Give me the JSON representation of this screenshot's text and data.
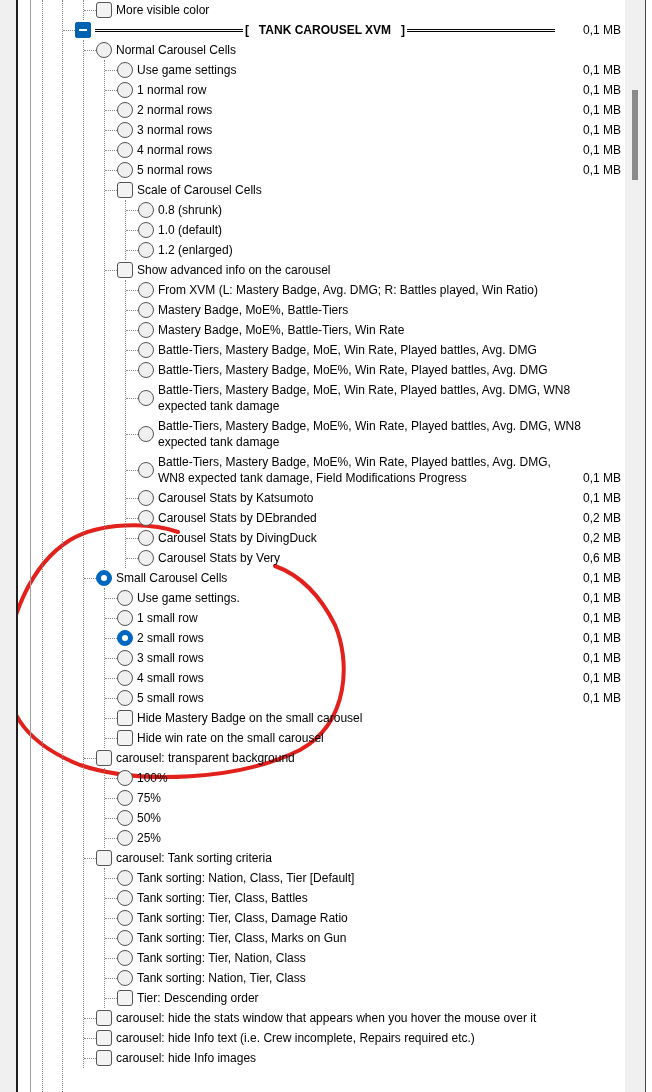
{
  "tree": {
    "items": [
      {
        "kind": "continued",
        "children": [
          {
            "kind": "checkbox",
            "label": "More visible color",
            "checked": false
          }
        ]
      },
      {
        "kind": "header",
        "label": "[   TANK CAROUSEL XVM   ]",
        "size": "0,1 MB",
        "expanded": true,
        "children": [
          {
            "kind": "radio",
            "label": "Normal Carousel Cells",
            "selected": false,
            "children": [
              {
                "kind": "radio",
                "label": "Use game settings",
                "selected": false,
                "size": "0,1 MB"
              },
              {
                "kind": "radio",
                "label": "1 normal row",
                "selected": false,
                "size": "0,1 MB"
              },
              {
                "kind": "radio",
                "label": "2 normal rows",
                "selected": false,
                "size": "0,1 MB"
              },
              {
                "kind": "radio",
                "label": "3 normal rows",
                "selected": false,
                "size": "0,1 MB"
              },
              {
                "kind": "radio",
                "label": "4 normal rows",
                "selected": false,
                "size": "0,1 MB"
              },
              {
                "kind": "radio",
                "label": "5 normal rows",
                "selected": false,
                "size": "0,1 MB"
              },
              {
                "kind": "checkbox",
                "label": "Scale of Carousel Cells",
                "checked": false,
                "children": [
                  {
                    "kind": "radio",
                    "label": "0.8 (shrunk)",
                    "selected": false
                  },
                  {
                    "kind": "radio",
                    "label": "1.0 (default)",
                    "selected": false
                  },
                  {
                    "kind": "radio",
                    "label": "1.2 (enlarged)",
                    "selected": false
                  }
                ]
              },
              {
                "kind": "checkbox",
                "label": "Show advanced info on the carousel",
                "checked": false,
                "children": [
                  {
                    "kind": "radio",
                    "label": "From XVM (L: Mastery Badge, Avg. DMG; R: Battles played, Win Ratio)",
                    "selected": false
                  },
                  {
                    "kind": "radio",
                    "label": "Mastery Badge, MoE%, Battle-Tiers",
                    "selected": false
                  },
                  {
                    "kind": "radio",
                    "label": "Mastery Badge, MoE%, Battle-Tiers, Win Rate",
                    "selected": false
                  },
                  {
                    "kind": "radio",
                    "label": "Battle-Tiers, Mastery Badge, MoE, Win Rate, Played battles, Avg. DMG",
                    "selected": false
                  },
                  {
                    "kind": "radio",
                    "label": "Battle-Tiers, Mastery Badge, MoE%, Win Rate, Played battles, Avg. DMG",
                    "selected": false
                  },
                  {
                    "kind": "radio",
                    "label": "Battle-Tiers, Mastery Badge, MoE, Win Rate, Played battles, Avg. DMG, WN8 expected tank damage",
                    "selected": false
                  },
                  {
                    "kind": "radio",
                    "label": "Battle-Tiers, Mastery Badge, MoE%, Win Rate, Played battles, Avg. DMG, WN8 expected tank damage",
                    "selected": false
                  },
                  {
                    "kind": "radio",
                    "label": "Battle-Tiers, Mastery Badge, MoE%, Win Rate, Played battles, Avg. DMG, WN8 expected tank damage, Field Modifications Progress",
                    "selected": false,
                    "size": "0,1 MB"
                  },
                  {
                    "kind": "radio",
                    "label": "Carousel Stats by Katsumoto",
                    "selected": false,
                    "size": "0,1 MB"
                  },
                  {
                    "kind": "radio",
                    "label": "Carousel Stats by DEbranded",
                    "selected": false,
                    "size": "0,2 MB"
                  },
                  {
                    "kind": "radio",
                    "label": "Carousel Stats by DivingDuck",
                    "selected": false,
                    "size": "0,2 MB"
                  },
                  {
                    "kind": "radio",
                    "label": "Carousel Stats by Very",
                    "selected": false,
                    "size": "0,6 MB"
                  }
                ]
              }
            ]
          },
          {
            "kind": "radio",
            "label": "Small Carousel Cells",
            "selected": true,
            "size": "0,1 MB",
            "children": [
              {
                "kind": "radio",
                "label": "Use game settings.",
                "selected": false,
                "size": "0,1 MB"
              },
              {
                "kind": "radio",
                "label": "1 small row",
                "selected": false,
                "size": "0,1 MB"
              },
              {
                "kind": "radio",
                "label": "2 small rows",
                "selected": true,
                "size": "0,1 MB"
              },
              {
                "kind": "radio",
                "label": "3 small rows",
                "selected": false,
                "size": "0,1 MB"
              },
              {
                "kind": "radio",
                "label": "4 small rows",
                "selected": false,
                "size": "0,1 MB"
              },
              {
                "kind": "radio",
                "label": "5 small rows",
                "selected": false,
                "size": "0,1 MB"
              },
              {
                "kind": "checkbox",
                "label": "Hide Mastery Badge on the small carousel",
                "checked": false
              },
              {
                "kind": "checkbox",
                "label": "Hide win rate on the small carousel",
                "checked": false
              }
            ]
          },
          {
            "kind": "checkbox",
            "label": "carousel: transparent background",
            "checked": false,
            "children": [
              {
                "kind": "radio",
                "label": "100%",
                "selected": false
              },
              {
                "kind": "radio",
                "label": "75%",
                "selected": false
              },
              {
                "kind": "radio",
                "label": "50%",
                "selected": false
              },
              {
                "kind": "radio",
                "label": "25%",
                "selected": false
              }
            ]
          },
          {
            "kind": "checkbox",
            "label": "carousel: Tank sorting criteria",
            "checked": false,
            "children": [
              {
                "kind": "radio",
                "label": "Tank sorting: Nation, Class, Tier [Default]",
                "selected": false
              },
              {
                "kind": "radio",
                "label": "Tank sorting: Tier, Class, Battles",
                "selected": false
              },
              {
                "kind": "radio",
                "label": "Tank sorting: Tier, Class, Damage Ratio",
                "selected": false
              },
              {
                "kind": "radio",
                "label": "Tank sorting: Tier, Class, Marks on Gun",
                "selected": false
              },
              {
                "kind": "radio",
                "label": "Tank sorting: Tier, Nation, Class",
                "selected": false
              },
              {
                "kind": "radio",
                "label": "Tank sorting: Nation, Tier, Class",
                "selected": false
              },
              {
                "kind": "checkbox",
                "label": "Tier: Descending order",
                "checked": false
              }
            ]
          },
          {
            "kind": "checkbox",
            "label": "carousel: hide the stats window that appears when you hover the mouse over it",
            "checked": false
          },
          {
            "kind": "checkbox",
            "label": "carousel: hide Info text (i.e. Crew incomplete, Repairs required etc.)",
            "checked": false
          },
          {
            "kind": "checkbox",
            "label": "carousel: hide Info images",
            "checked": false
          }
        ]
      }
    ]
  }
}
